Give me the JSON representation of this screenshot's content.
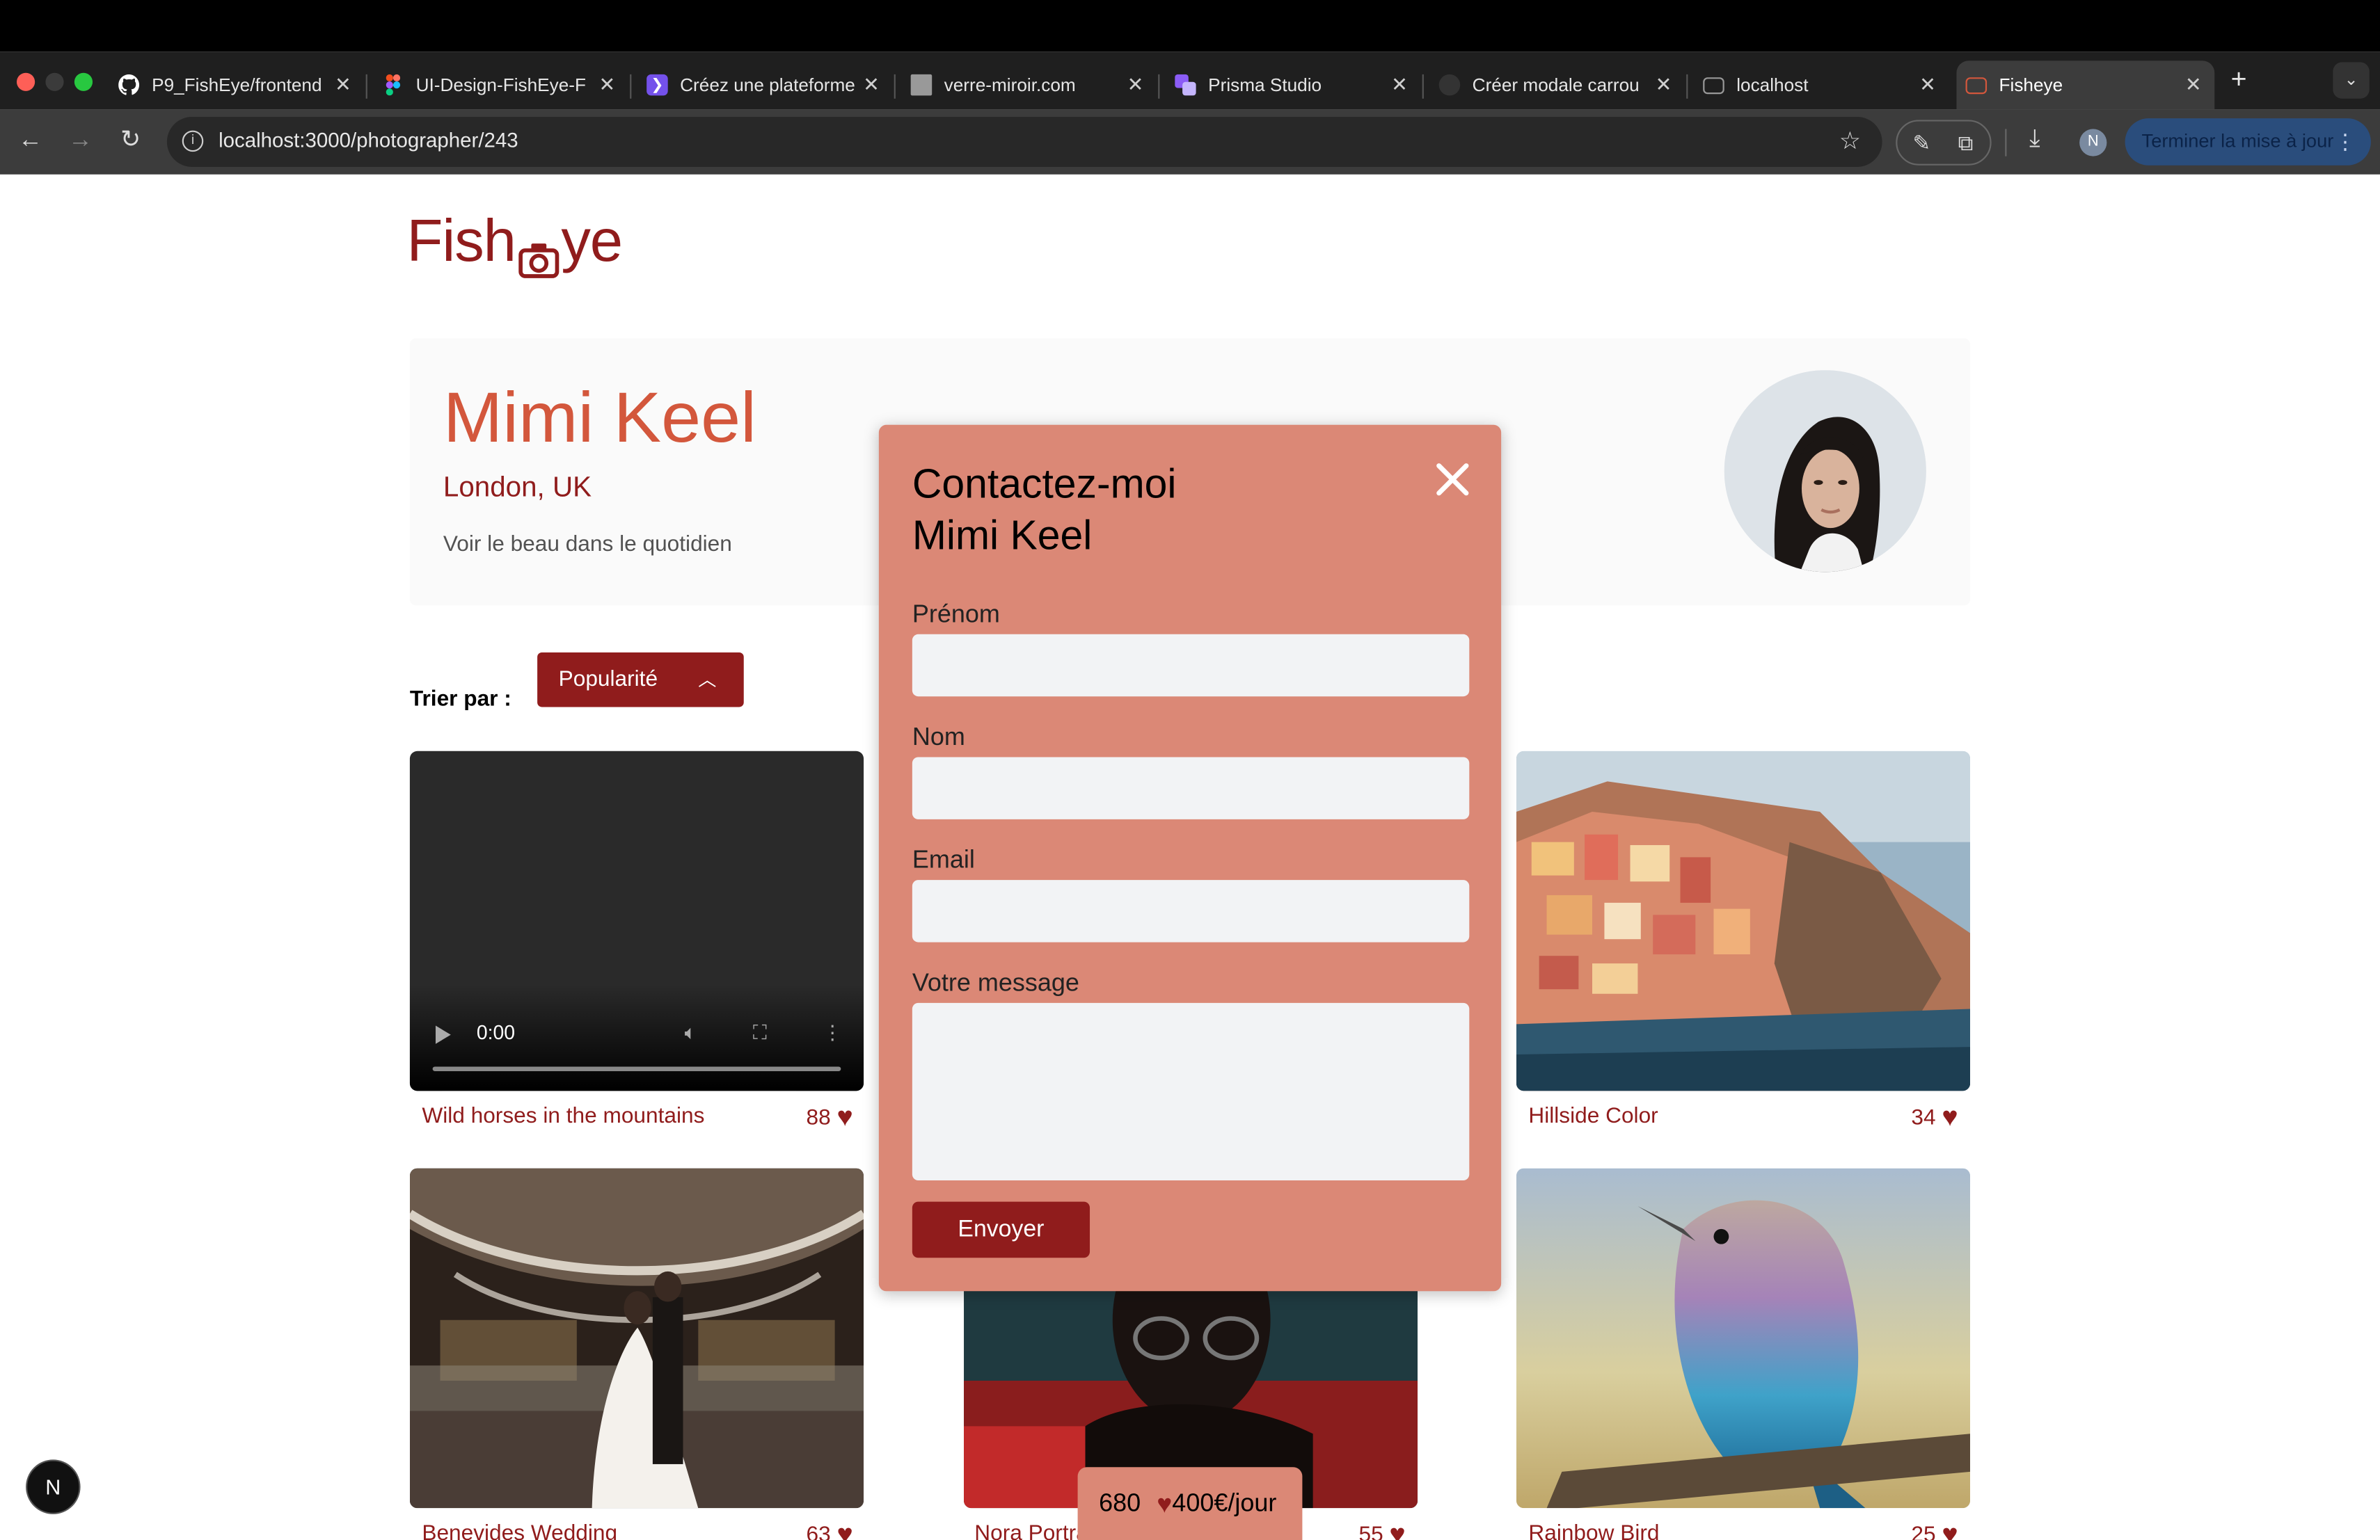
{
  "browser": {
    "tabs": [
      {
        "title": "P9_FishEye/frontend",
        "icon": "github-icon",
        "favicon_color": "#ffffff"
      },
      {
        "title": "UI-Design-FishEye-F",
        "icon": "figma-icon",
        "favicon_color": "#f24e1e"
      },
      {
        "title": "Créez une plateforme",
        "icon": "openclassrooms-icon",
        "favicon_color": "#7451eb"
      },
      {
        "title": "verre-miroir.com",
        "icon": "site-icon",
        "favicon_color": "#999999"
      },
      {
        "title": "Prisma Studio",
        "icon": "prisma-icon",
        "favicon_color": "#8b5cf6"
      },
      {
        "title": "Créer modale carrou",
        "icon": "chatgpt-icon",
        "favicon_color": "#333333"
      },
      {
        "title": "localhost",
        "icon": "camera-icon",
        "favicon_color": "#777777"
      },
      {
        "title": "Fisheye",
        "icon": "fisheye-icon",
        "favicon_color": "#d3573c",
        "active": true
      }
    ],
    "url": "localhost:3000/photographer/243",
    "profile_initial": "N",
    "update_button": "Terminer la mise à jour"
  },
  "site": {
    "logo_prefix": "Fish",
    "logo_suffix": "ye",
    "brand_color": "#901c1c",
    "accent_color": "#d3573c",
    "modal_color": "#db8876"
  },
  "photographer": {
    "name": "Mimi Keel",
    "location": "London, UK",
    "tagline": "Voir le beau dans le quotidien"
  },
  "sort": {
    "label": "Trier par :",
    "selected": "Popularité"
  },
  "media": [
    {
      "title": "Wild horses in the mountains",
      "likes": "88",
      "type": "video",
      "time": "0:00"
    },
    {
      "title": "Hillside Color",
      "likes": "34",
      "type": "image"
    },
    {
      "title": "Benevides Wedding",
      "likes": "63",
      "type": "image"
    },
    {
      "title": "Nora Portrait",
      "likes": "55",
      "type": "image"
    },
    {
      "title": "Rainbow Bird",
      "likes": "25",
      "type": "image"
    }
  ],
  "stats": {
    "total_likes": "680",
    "price": "400€/jour"
  },
  "modal": {
    "title_line1": "Contactez-moi",
    "title_line2": "Mimi Keel",
    "first_name_label": "Prénom",
    "last_name_label": "Nom",
    "email_label": "Email",
    "message_label": "Votre message",
    "submit_label": "Envoyer"
  },
  "nextjs_badge": "N"
}
